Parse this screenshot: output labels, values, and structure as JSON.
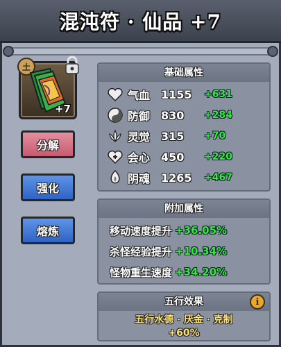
{
  "title": "混沌符 · 仙品 +7",
  "item": {
    "level_badge": "+7",
    "icon": "talisman-icon",
    "corner_badge_icon": "seal-icon",
    "locked": true
  },
  "buttons": {
    "split": "分解",
    "enhance": "强化",
    "fuse": "熔炼"
  },
  "base_attributes": {
    "header": "基础属性",
    "rows": [
      {
        "icon": "heart-icon",
        "name": "气血",
        "value": "1155",
        "bonus": "+631"
      },
      {
        "icon": "yin-yang-icon",
        "name": "防御",
        "value": "830",
        "bonus": "+284"
      },
      {
        "icon": "lotus-icon",
        "name": "灵觉",
        "value": "315",
        "bonus": "+70"
      },
      {
        "icon": "crit-heart-icon",
        "name": "会心",
        "value": "450",
        "bonus": "+220"
      },
      {
        "icon": "soul-flame-icon",
        "name": "阴魂",
        "value": "1265",
        "bonus": "+467"
      }
    ]
  },
  "extra_attributes": {
    "header": "附加属性",
    "rows": [
      {
        "name": "移动速度提升",
        "value": "+36.05%"
      },
      {
        "name": "杀怪经验提升",
        "value": "+10.34%"
      },
      {
        "name": "怪物重生速度",
        "value": "+34.20%"
      }
    ]
  },
  "five_elements": {
    "header": "五行效果",
    "effect": "五行水德 · 厌金 · 克制",
    "value": "+60%",
    "info_icon": "i"
  },
  "colors": {
    "bonus_green": "#37e83b",
    "effect_yellow": "#ffe27a",
    "panel_bg": "#8a92a2"
  }
}
